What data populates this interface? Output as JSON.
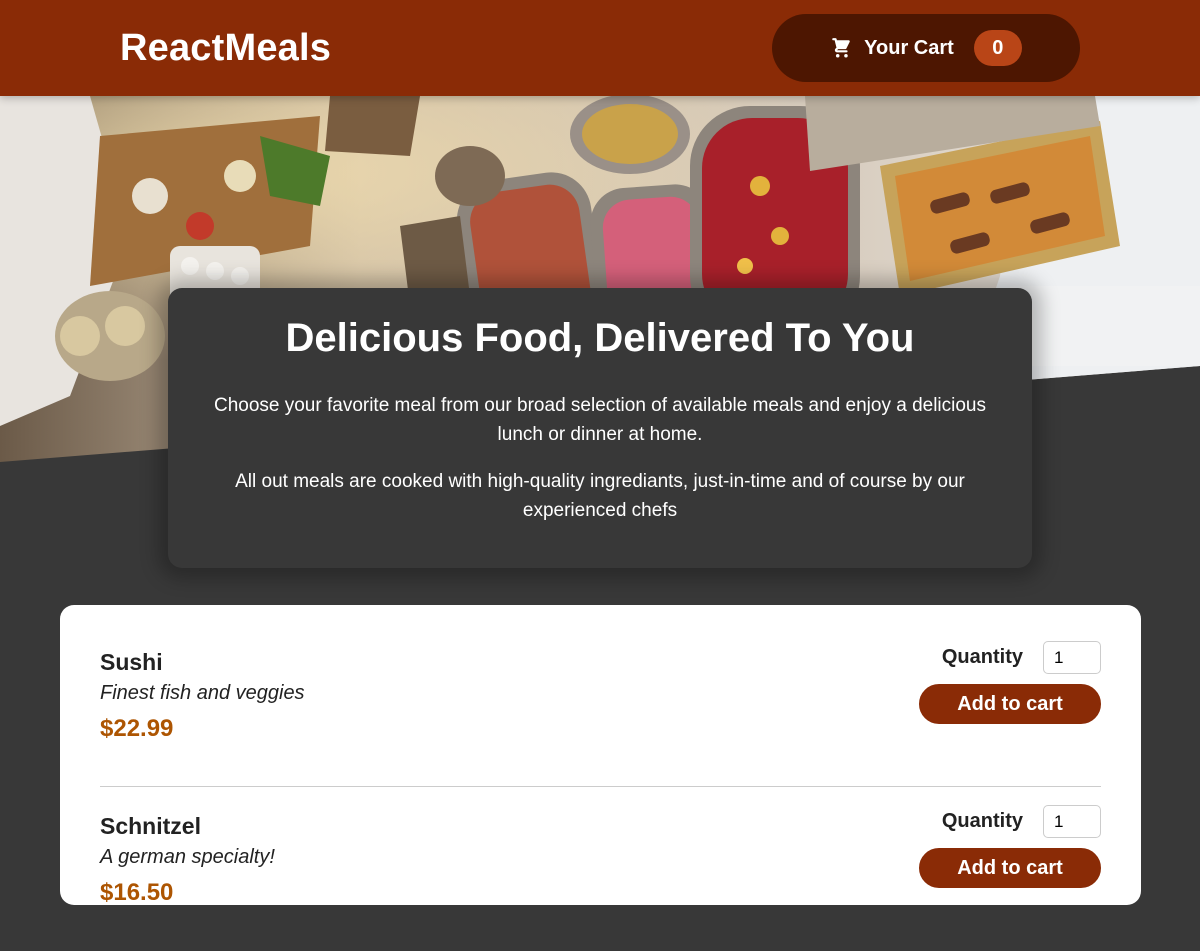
{
  "header": {
    "brand": "ReactMeals",
    "cart_label": "Your Cart",
    "cart_count": "0",
    "cart_icon": "cart-icon"
  },
  "hero": {
    "image": "buffet-table-photo"
  },
  "summary": {
    "title": "Delicious Food, Delivered To You",
    "paragraph1": "Choose your favorite meal from our broad selection of available meals and enjoy a delicious lunch or dinner at home.",
    "paragraph2": "All out meals are cooked with high-quality ingrediants, just-in-time and of course by our experienced chefs"
  },
  "meals": [
    {
      "name": "Sushi",
      "description": "Finest fish and veggies",
      "price": "$22.99",
      "quantity_label": "Quantity",
      "quantity": "1",
      "add_label": "Add to cart"
    },
    {
      "name": "Schnitzel",
      "description": "A german specialty!",
      "price": "$16.50",
      "quantity_label": "Quantity",
      "quantity": "1",
      "add_label": "Add to cart"
    }
  ],
  "colors": {
    "header_bg": "#8a2b06",
    "cart_bg": "#4d1601",
    "badge_bg": "#b94517",
    "page_bg": "#383838",
    "price": "#ad5502"
  }
}
